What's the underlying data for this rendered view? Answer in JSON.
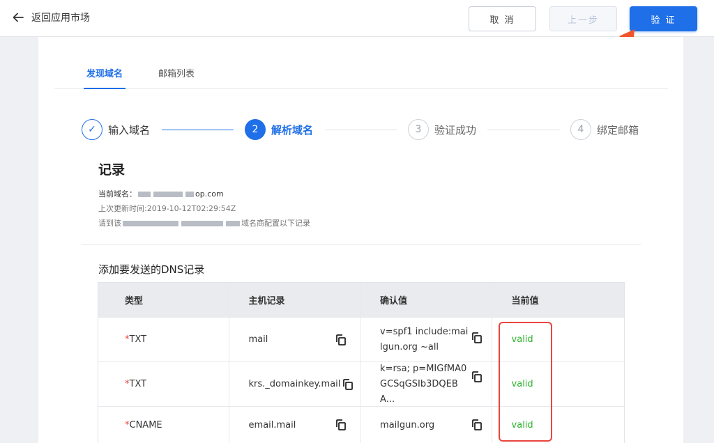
{
  "topbar": {
    "back_label": "返回应用市场",
    "cancel_label": "取 消",
    "prev_label": "上一步",
    "verify_label": "验 证"
  },
  "tabs": [
    "发现域名",
    "邮箱列表"
  ],
  "steps": [
    {
      "num": "✓",
      "label": "输入域名",
      "state": "done"
    },
    {
      "num": "2",
      "label": "解析域名",
      "state": "active"
    },
    {
      "num": "3",
      "label": "验证成功",
      "state": "todo"
    },
    {
      "num": "4",
      "label": "绑定邮箱",
      "state": "todo"
    }
  ],
  "record": {
    "title": "记录",
    "domain_prefix": "当前域名：",
    "domain_suffix": "op.com",
    "updated": "上次更新时间:2019-10-12T02:29:54Z",
    "instruction_prefix": "请到该",
    "instruction_suffix": "域名商配置以下记录"
  },
  "dns": {
    "title": "添加要发送的DNS记录",
    "headers": [
      "类型",
      "主机记录",
      "确认值",
      "当前值"
    ],
    "rows": [
      {
        "required": "*",
        "type": "TXT",
        "host": "mail",
        "value": "v=spf1 include:mailgun.org ~all",
        "current": "valid"
      },
      {
        "required": "*",
        "type": "TXT",
        "host": "krs._domainkey.mail",
        "value": "k=rsa; p=MIGfMA0GCSqGSIb3DQEBA...",
        "current": "valid"
      },
      {
        "required": "*",
        "type": "CNAME",
        "host": "email.mail",
        "value": "mailgun.org",
        "current": "valid"
      }
    ]
  },
  "colors": {
    "primary": "#1e6fe8",
    "valid": "#2bb32b",
    "annotation": "#e8453c"
  }
}
